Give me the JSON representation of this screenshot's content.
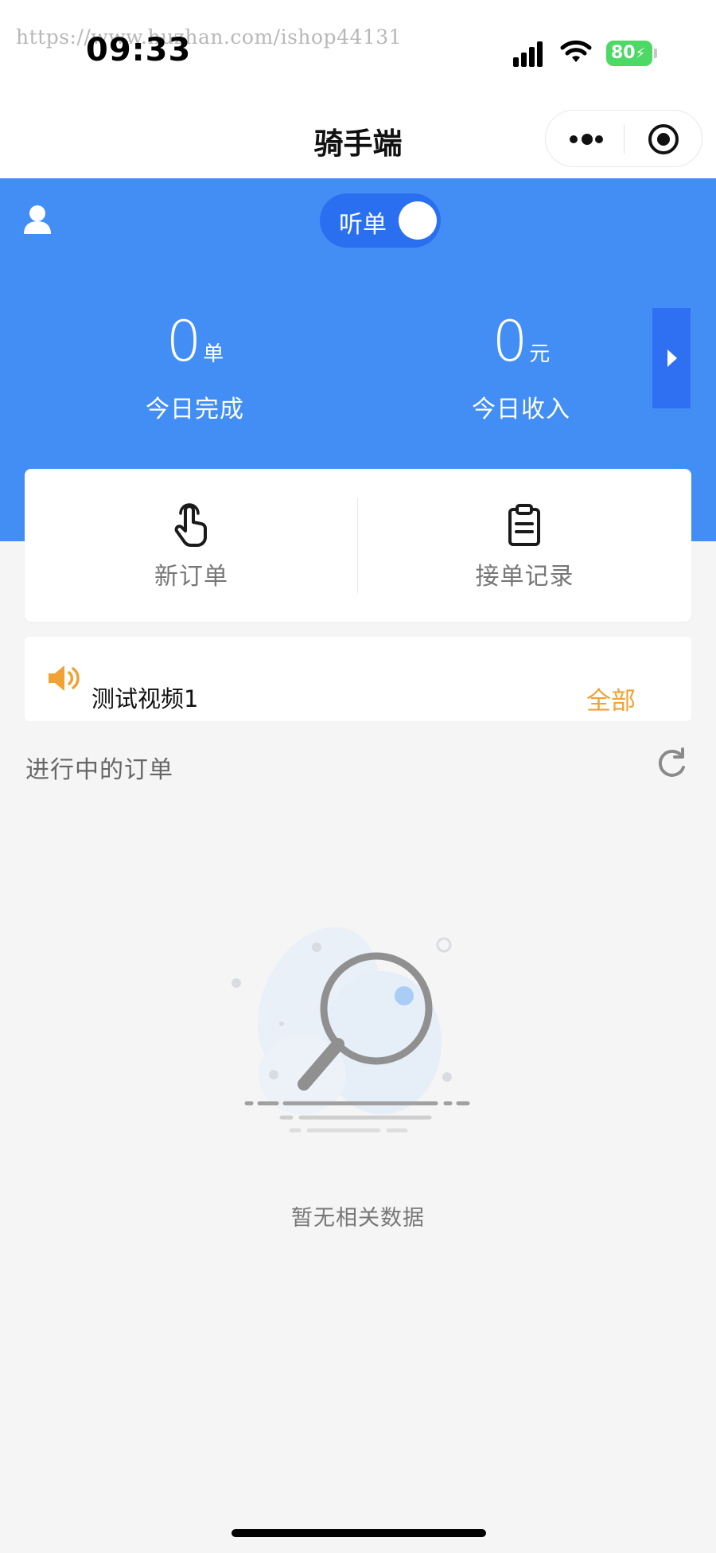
{
  "status_bar": {
    "watermark": "https://www.huzhan.com/ishop44131",
    "time": "09:33",
    "battery": "80"
  },
  "nav": {
    "title": "骑手端"
  },
  "header": {
    "toggle_label": "听单",
    "toggle_on": true,
    "stats": [
      {
        "value": "0",
        "unit": "单",
        "label": "今日完成"
      },
      {
        "value": "0",
        "unit": "元",
        "label": "今日收入"
      }
    ]
  },
  "actions": [
    {
      "label": "新订单",
      "icon": "tap-hand-icon"
    },
    {
      "label": "接单记录",
      "icon": "clipboard-icon"
    }
  ],
  "notice": {
    "text": "测试视频1",
    "link": "全部"
  },
  "orders": {
    "section_title": "进行中的订单",
    "empty_text": "暂无相关数据"
  },
  "colors": {
    "primary_blue": "#428ef5",
    "accent_orange": "#f0a233",
    "battery_green": "#4cd964"
  }
}
